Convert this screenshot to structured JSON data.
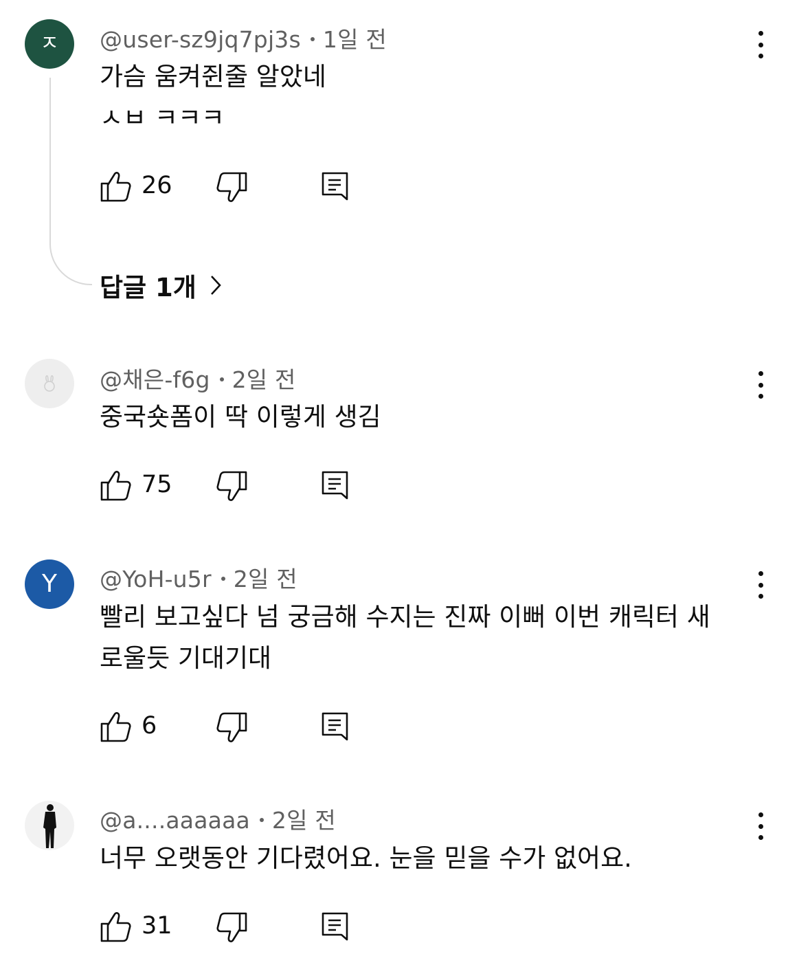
{
  "comments": [
    {
      "avatar_letter": "ㅈ",
      "avatar_color": "#1e5341",
      "author": "@user-sz9jq7pj3s",
      "time": "1일 전",
      "lines": [
        "가슴 움켜쥔줄 알았네",
        "ㅅㅂ ㅋㅋㅋ"
      ],
      "likes": "26",
      "replies_label": "답글 1개"
    },
    {
      "avatar_icon": "rabbit-icon",
      "avatar_color": "#eeeeee",
      "author": "@채은-f6g",
      "time": "2일 전",
      "lines": [
        "중국숏폼이 딱 이렇게 생김"
      ],
      "likes": "75"
    },
    {
      "avatar_letter": "Y",
      "avatar_color": "#1c5aa6",
      "author": "@YoH-u5r",
      "time": "2일 전",
      "lines": [
        "빨리 보고싶다 넘 궁금해 수지는 진짜 이뻐 이번 캐릭터 새",
        "로울듯 기대기대"
      ],
      "likes": "6"
    },
    {
      "avatar_icon": "silhouette-photo",
      "avatar_color": "#f2f2f2",
      "author": "@a....aaaaaa",
      "time": "2일 전",
      "lines": [
        "너무 오랫동안 기다렸어요. 눈을 믿을 수가 없어요."
      ],
      "likes": "31"
    }
  ],
  "icons": {
    "like": "thumb-up-icon",
    "dislike": "thumb-down-icon",
    "reply": "reply-comment-icon",
    "menu": "more-vert-icon",
    "chevron": "chevron-right-icon"
  }
}
